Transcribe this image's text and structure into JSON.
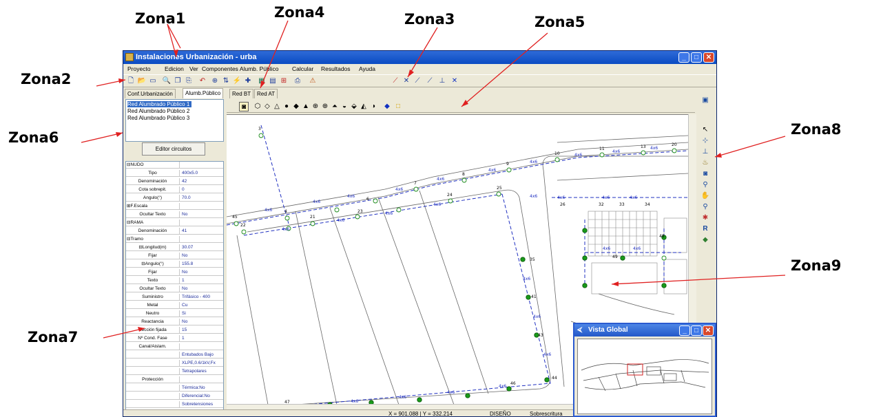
{
  "annotations": [
    "Zona1",
    "Zona2",
    "Zona3",
    "Zona4",
    "Zona5",
    "Zona6",
    "Zona7",
    "Zona8",
    "Zona9"
  ],
  "window": {
    "title": "Instalaciones Urbanización - urba"
  },
  "menu": [
    "Proyecto",
    "Edicion",
    "Ver",
    "Componentes Alumb. Público",
    "Calcular",
    "Resultados",
    "Ayuda"
  ],
  "tabs": [
    "Conf.Urbanización",
    "Alumb.Público",
    "Red BT",
    "Red AT"
  ],
  "network_list": [
    "Red Alumbrado Público 1",
    "Red Alumbrado Público 2",
    "Red Alumbrado Público 3"
  ],
  "editor_button": "Editor circuitos",
  "properties": [
    {
      "name": "⊟NUDO",
      "value": "",
      "head": true
    },
    {
      "name": "Tipo",
      "value": "400x5.0"
    },
    {
      "name": "Denominación",
      "value": "42"
    },
    {
      "name": "Cota sobrepit.",
      "value": "0"
    },
    {
      "name": "Angulo(°)",
      "value": "70.0"
    },
    {
      "name": "⊞F.Escala",
      "value": "",
      "head": true
    },
    {
      "name": "Ocultar Texto",
      "value": "No"
    },
    {
      "name": "⊟RAMA",
      "value": "",
      "head": true
    },
    {
      "name": "Denominación",
      "value": "41"
    },
    {
      "name": "⊟Tramo",
      "value": "",
      "head": true
    },
    {
      "name": "⊟Longitud(m)",
      "value": "30.07"
    },
    {
      "name": "Fijar",
      "value": "No"
    },
    {
      "name": "⊟Angulo(°)",
      "value": "155.8"
    },
    {
      "name": "Fijar",
      "value": "No"
    },
    {
      "name": "Texto",
      "value": "1"
    },
    {
      "name": "Ocultar Texto",
      "value": "No"
    },
    {
      "name": "Suministro",
      "value": "Trifásico - 400"
    },
    {
      "name": "Metal",
      "value": "Cu"
    },
    {
      "name": "Neutro",
      "value": "Si"
    },
    {
      "name": "Reactancia",
      "value": "No"
    },
    {
      "name": "Sección fijada",
      "value": "15"
    },
    {
      "name": "Nº Cond. Fase",
      "value": "1"
    },
    {
      "name": "Canal/Aislam.",
      "value": ""
    },
    {
      "name": "",
      "value": "Entubados Bajo"
    },
    {
      "name": "",
      "value": "XLPE,0.6/1kV,Fx"
    },
    {
      "name": "",
      "value": "Tetrapolares"
    },
    {
      "name": "Protección",
      "value": ""
    },
    {
      "name": "",
      "value": "Térmica:No"
    },
    {
      "name": "",
      "value": "Diferencial:No"
    },
    {
      "name": "",
      "value": "Sobretensiones"
    }
  ],
  "status": {
    "coords": "X = 901.088 | Y = 332.214",
    "mode": "DISEÑO",
    "write_mode": "Sobrescritura"
  },
  "vista_global": {
    "title": "Vista Global"
  },
  "node_labels": [
    "45",
    "3",
    "4",
    "6",
    "7",
    "8",
    "9",
    "10",
    "11",
    "13",
    "20",
    "21",
    "22",
    "23",
    "24",
    "25",
    "26",
    "32",
    "33",
    "34",
    "35",
    "41",
    "43",
    "44",
    "46",
    "47",
    "48",
    "49"
  ],
  "cable_label": "4x6"
}
